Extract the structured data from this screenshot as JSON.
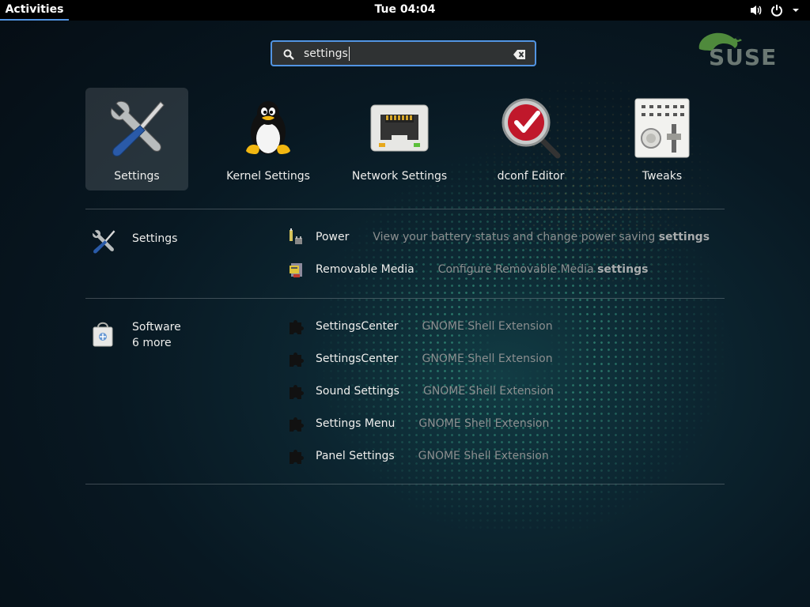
{
  "topbar": {
    "activities": "Activities",
    "clock": "Tue 04:04"
  },
  "search": {
    "value": "settings"
  },
  "brand": {
    "logo_text": "SUSE"
  },
  "apps": [
    {
      "label": "Settings",
      "icon": "settings-tools-icon",
      "selected": true
    },
    {
      "label": "Kernel Settings",
      "icon": "tux-penguin-icon"
    },
    {
      "label": "Network Settings",
      "icon": "network-port-icon"
    },
    {
      "label": "dconf Editor",
      "icon": "dconf-editor-icon"
    },
    {
      "label": "Tweaks",
      "icon": "tweaks-icon"
    }
  ],
  "providers": [
    {
      "name": "Settings",
      "icon": "settings-tools-icon",
      "results": [
        {
          "title": "Power",
          "desc_prefix": "View your battery status and change power saving ",
          "desc_bold": "settings",
          "icon": "power-icon"
        },
        {
          "title": "Removable Media",
          "desc_prefix": "Configure Removable Media ",
          "desc_bold": "settings",
          "icon": "removable-media-icon"
        }
      ]
    },
    {
      "name": "Software",
      "more": "6 more",
      "icon": "software-bag-icon",
      "results": [
        {
          "title": "SettingsCenter",
          "desc": "GNOME Shell Extension",
          "icon": "puzzle-icon"
        },
        {
          "title": "SettingsCenter",
          "desc": "GNOME Shell Extension",
          "icon": "puzzle-icon"
        },
        {
          "title": "Sound Settings",
          "desc": "GNOME Shell Extension",
          "icon": "puzzle-icon"
        },
        {
          "title": "Settings Menu",
          "desc": "GNOME Shell Extension",
          "icon": "puzzle-icon"
        },
        {
          "title": "Panel Settings",
          "desc": "GNOME Shell Extension",
          "icon": "puzzle-icon"
        }
      ]
    }
  ],
  "colors": {
    "accent": "#5294e2",
    "topbar": "#000000"
  }
}
